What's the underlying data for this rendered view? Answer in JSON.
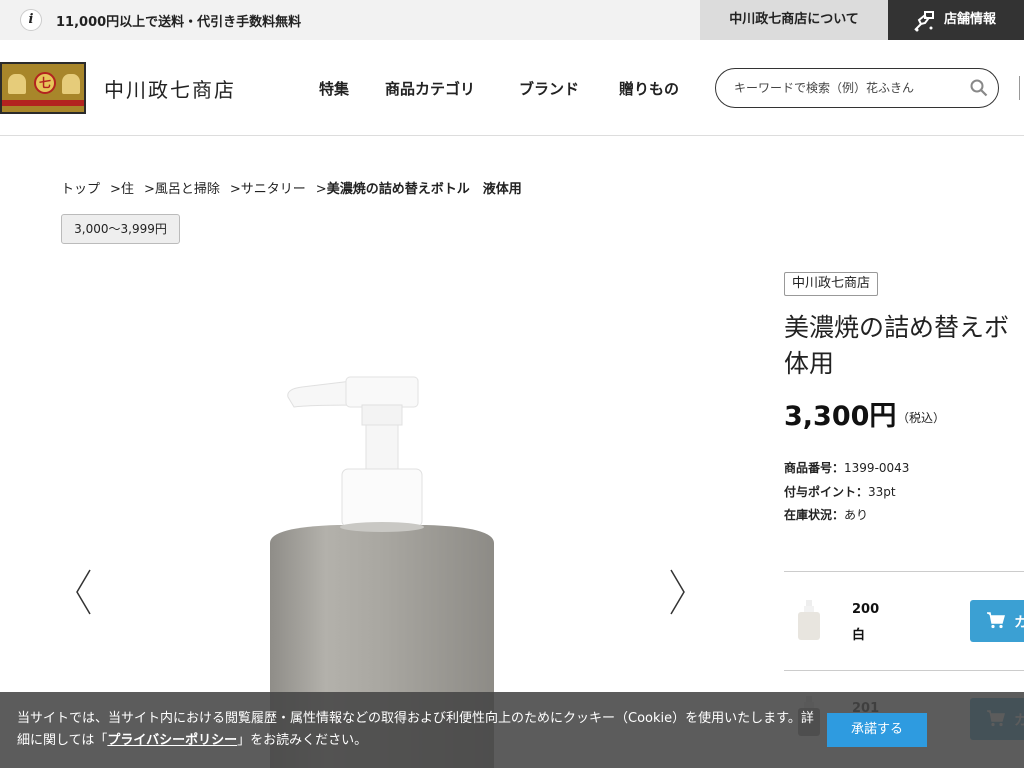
{
  "topbar": {
    "info_icon": "i",
    "shipping_notice": "11,000円以上で送料・代引き手数料無料",
    "about_link": "中川政七商店について",
    "store_info": "店舗情報"
  },
  "header": {
    "logo_text": "中川政七商店",
    "logo_mark": "七",
    "nav": [
      "特集",
      "商品カテゴリ",
      "ブランド",
      "贈りもの"
    ],
    "search_placeholder": "キーワードで検索（例）花ふきん"
  },
  "breadcrumb": {
    "items": [
      "トップ",
      "住",
      "風呂と掃除",
      "サニタリー"
    ],
    "separator": ">",
    "current": "美濃焼の詰め替えボトル　液体用"
  },
  "price_range_tag": "3,000〜3,999円",
  "product": {
    "maker": "中川政七商店",
    "title_line1": "美濃焼の詰め替えボ",
    "title_line2": "体用",
    "price": "3,300円",
    "tax_note": "（税込）",
    "specs": [
      {
        "label": "商品番号",
        "sep": "：",
        "value": "1399-0043"
      },
      {
        "label": "付与ポイント",
        "sep": "：",
        "value": "33pt"
      },
      {
        "label": "在庫状況",
        "sep": "：",
        "value": "あり"
      }
    ],
    "variants": [
      {
        "code": "200",
        "color": "白",
        "cart_label": "カ"
      },
      {
        "code": "201",
        "color": "",
        "cart_label": "カ"
      }
    ]
  },
  "gallery": {
    "prev_label": "‹",
    "next_label": "›"
  },
  "cookie": {
    "text_before": "当サイトでは、当サイト内における閲覧履歴・属性情報などの取得および利便性向上のためにクッキー（Cookie）を使用いたします。詳細に関しては「",
    "policy_link": "プライバシーポリシー",
    "text_after": "」をお読みください。",
    "accept_label": "承諾する"
  },
  "colors": {
    "accent_blue": "#3ba0d3",
    "accept_blue": "#2e9be0",
    "dark_bar": "#333333",
    "bottle_gray": "#a8a6a0"
  }
}
